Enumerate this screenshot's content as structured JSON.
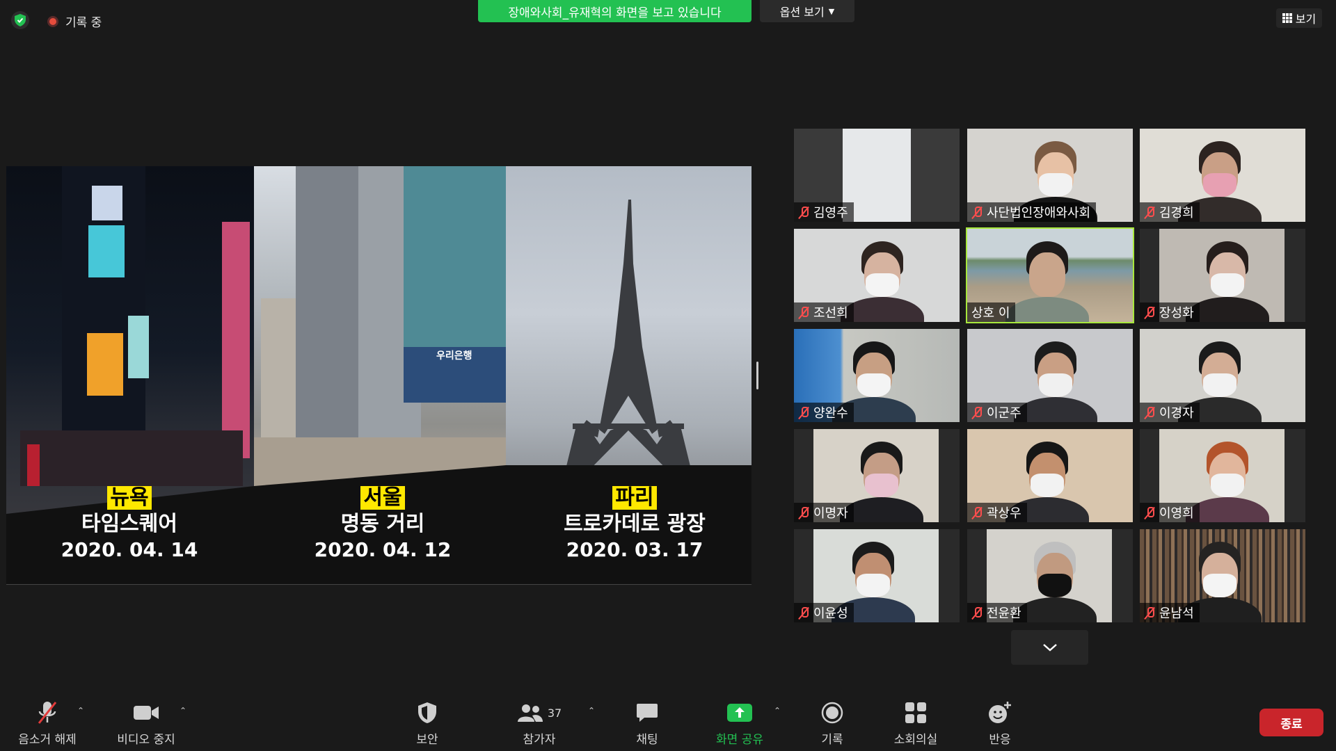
{
  "top": {
    "recording_label": "기록 중",
    "share_banner": "장애와사회_유재혁의 화면을 보고 있습니다",
    "options_label": "옵션 보기",
    "view_label": "보기"
  },
  "shared_screen": {
    "captions": [
      {
        "city": "뉴욕",
        "place": "타임스퀘어",
        "date": "2020. 04. 14"
      },
      {
        "city": "서울",
        "place": "명동 거리",
        "date": "2020. 04. 12"
      },
      {
        "city": "파리",
        "place": "트로카데로 광장",
        "date": "2020. 03. 17"
      }
    ],
    "sign_woori": "우리은행"
  },
  "participants": [
    {
      "name": "김영주",
      "muted": true
    },
    {
      "name": "사단법인장애와사회",
      "muted": true
    },
    {
      "name": "김경희",
      "muted": true
    },
    {
      "name": "조선희",
      "muted": true
    },
    {
      "name": "상호 이",
      "muted": false,
      "active_speaker": true
    },
    {
      "name": "장성화",
      "muted": true
    },
    {
      "name": "양완수",
      "muted": true
    },
    {
      "name": "이군주",
      "muted": true
    },
    {
      "name": "이경자",
      "muted": true
    },
    {
      "name": "이명자",
      "muted": true
    },
    {
      "name": "곽상우",
      "muted": true
    },
    {
      "name": "이영희",
      "muted": true
    },
    {
      "name": "이윤성",
      "muted": true
    },
    {
      "name": "전윤환",
      "muted": true
    },
    {
      "name": "윤남석",
      "muted": true
    }
  ],
  "toolbar": {
    "unmute": "음소거 해제",
    "stop_video": "비디오 중지",
    "security": "보안",
    "participants": "참가자",
    "participant_count": "37",
    "chat": "채팅",
    "share_screen": "화면 공유",
    "record": "기록",
    "breakout": "소회의실",
    "reactions": "반응",
    "end": "종료"
  },
  "colors": {
    "share_green": "#23c152",
    "active_outline": "#a8e83c",
    "end_red": "#c9252b",
    "mute_red": "#ff4d4d"
  }
}
